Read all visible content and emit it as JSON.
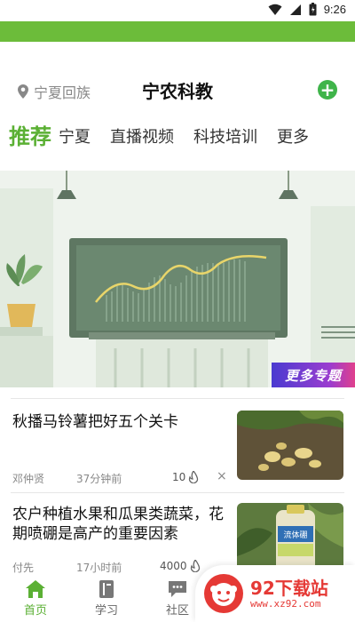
{
  "status_bar": {
    "time": "9:26"
  },
  "header": {
    "location": "宁夏回族",
    "title": "宁农科教",
    "add_label": "+"
  },
  "tabs": [
    {
      "label": "推荐",
      "active": true
    },
    {
      "label": "宁夏",
      "active": false
    },
    {
      "label": "直播视频",
      "active": false
    },
    {
      "label": "科技培训",
      "active": false
    },
    {
      "label": "更多",
      "active": false
    }
  ],
  "banner": {
    "tag": "更多专题"
  },
  "articles": [
    {
      "title": "秋播马铃薯把好五个关卡",
      "author": "邓仲贤",
      "time": "37分钟前",
      "likes": "10",
      "close": "×"
    },
    {
      "title": "农户种植水果和瓜果类蔬菜，花期喷硼是高产的重要因素",
      "author": "付先",
      "time": "17小时前",
      "likes": "4000",
      "close": "×",
      "thumb_label": "流体硼"
    }
  ],
  "bottom_nav": [
    {
      "label": "首页",
      "active": true
    },
    {
      "label": "学习",
      "active": false
    },
    {
      "label": "社区",
      "active": false
    }
  ],
  "watermark": {
    "brand": "92下载站",
    "url": "www.xz92.com"
  },
  "colors": {
    "brand_green": "#5bb034",
    "top_bar": "#6cbc3a",
    "add_button": "#3fb44a",
    "watermark_red": "#e53935"
  }
}
